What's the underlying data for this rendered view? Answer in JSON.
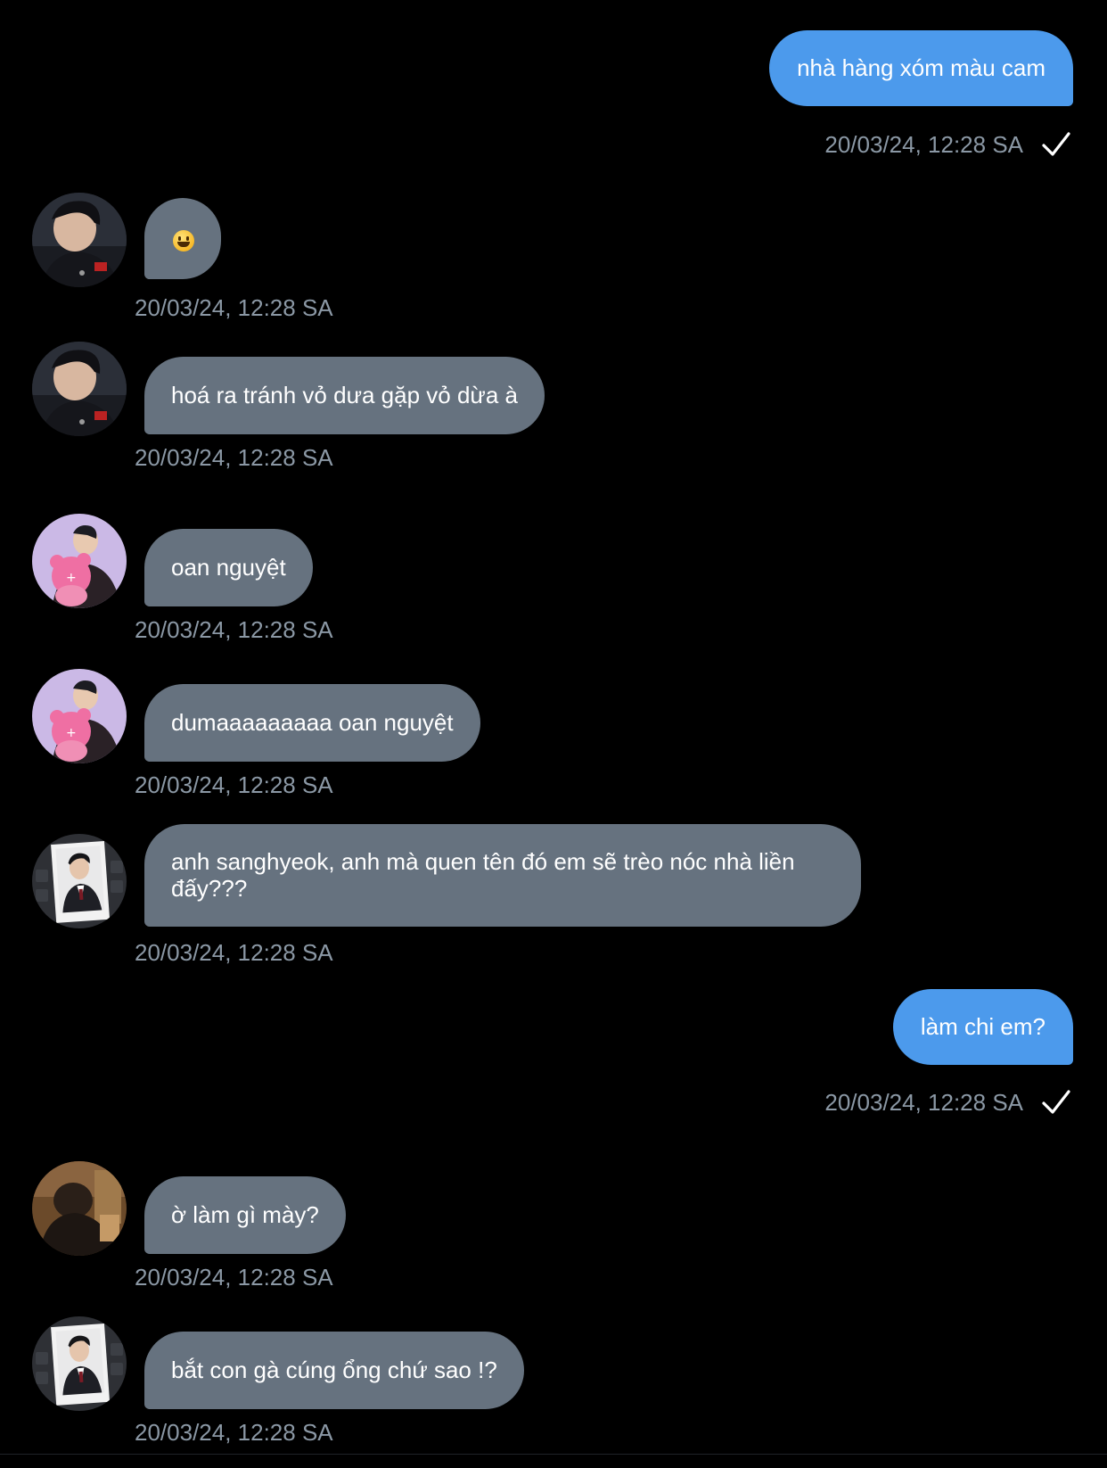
{
  "messages": [
    {
      "direction": "out",
      "text": "nhà hàng xóm màu cam",
      "time": "20/03/24, 12:28 SA"
    },
    {
      "direction": "in",
      "avatar": "avatar-a",
      "emoji": "smiley-emoji",
      "time": "20/03/24, 12:28 SA"
    },
    {
      "direction": "in",
      "avatar": "avatar-a",
      "text": "hoá ra tránh vỏ dưa gặp vỏ dừa à",
      "time": "20/03/24, 12:28 SA"
    },
    {
      "direction": "in",
      "avatar": "avatar-b",
      "text": "oan nguyệt",
      "time": "20/03/24, 12:28 SA"
    },
    {
      "direction": "in",
      "avatar": "avatar-b",
      "text": "dumaaaaaaaaa oan nguyệt",
      "time": "20/03/24, 12:28 SA"
    },
    {
      "direction": "in",
      "avatar": "avatar-c",
      "text": "anh sanghyeok, anh mà quen tên đó em sẽ trèo nóc nhà liền đấy???",
      "time": "20/03/24, 12:28 SA"
    },
    {
      "direction": "out",
      "text": "làm chi em?",
      "time": "20/03/24, 12:28 SA"
    },
    {
      "direction": "in",
      "avatar": "avatar-d",
      "text": "ờ làm gì mày?",
      "time": "20/03/24, 12:28 SA"
    },
    {
      "direction": "in",
      "avatar": "avatar-c",
      "text": "bắt con gà cúng ổng chứ sao !?",
      "time": "20/03/24, 12:28 SA"
    }
  ],
  "colors": {
    "background": "#000000",
    "outgoing_bubble": "#4c9aec",
    "incoming_bubble": "#66727f",
    "timestamp": "#8b98a5"
  },
  "icons": {
    "read_receipt": "checkmark-icon",
    "emoji": "smiley-emoji"
  }
}
